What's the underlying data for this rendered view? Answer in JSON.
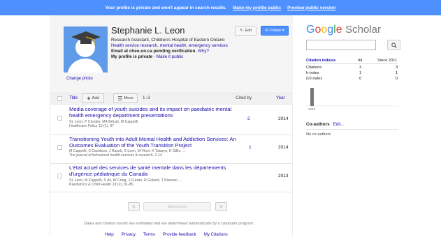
{
  "banner": {
    "message": "Your profile is private and won't appear in search results.",
    "make_public": "Make my profile public",
    "preview": "Preview public version"
  },
  "profile": {
    "name": "Stephanie L. Leon",
    "affiliation": "Research Assistant, Children's Hospital of Eastern Ontario",
    "interests": "Health service research, mental health, emergency services",
    "email_status": "Email at cheo.on.ca pending verification.",
    "email_why": "Why?",
    "private_label": "My profile is private",
    "make_public": "- Make it public",
    "change_photo": "Change photo",
    "edit_label": "Edit",
    "follow_label": "Follow"
  },
  "toolbar": {
    "title": "Title",
    "add": "Add",
    "more": "More",
    "range": "1–3",
    "cited_by": "Cited by",
    "year": "Year"
  },
  "papers": [
    {
      "title": "Media coverage of youth suicides and its impact on paediatric mental health emergency department presentations",
      "authors": "SL Leon, P Cloutier, MA BéLair, M Cappelli",
      "venue": "Healthcare Policy 10 (1), 97",
      "cited": "2",
      "year": "2014"
    },
    {
      "title": "Transitioning Youth into Adult Mental Health and Addiction Services: An Outcomes Evaluation of the Youth Transition Project",
      "authors": "M Cappelli, S Davidson, J Racek, S Leon, M Vloet, K Tataryn, K Gillis, ...",
      "venue": "The journal of behavioral health services & research, 1-14",
      "cited": "1",
      "year": "2014"
    },
    {
      "title": "L'état actuel des services de santé mentale dans les départements d'urgence pédiatrique du Canada",
      "authors": "SL Leon, M Cappelli, S Ali, W Craig, J Curran, R Gokiert, T Klassen, ...",
      "venue": "Paediatrics & Child Health 18 (2), 81-85",
      "cited": "",
      "year": "2013"
    }
  ],
  "pager": {
    "prev": "<",
    "show_more": "Show more",
    "next": ">"
  },
  "footer": {
    "note": "Dates and citation counts are estimated and are determined automatically by a computer program.",
    "links": [
      "Help",
      "Privacy",
      "Terms",
      "Provide feedback",
      "My Citations"
    ]
  },
  "sidebar": {
    "logo_google": [
      "G",
      "o",
      "o",
      "g",
      "l",
      "e"
    ],
    "logo_colors": [
      "#4285f4",
      "#ea4335",
      "#fbbc05",
      "#4285f4",
      "#34a853",
      "#ea4335"
    ],
    "logo_scholar": "Scholar",
    "citation_indices": {
      "header": "Citation indices",
      "col_all": "All",
      "col_since": "Since 2011",
      "rows": [
        {
          "label": "Citations",
          "all": "3",
          "since": "3"
        },
        {
          "label": "h-index",
          "all": "1",
          "since": "1"
        },
        {
          "label": "i10-index",
          "all": "0",
          "since": "0"
        }
      ]
    },
    "coauthors_title": "Co-authors",
    "coauthors_edit": "Edit...",
    "no_coauthors": "No co-authors"
  },
  "chart_data": {
    "type": "bar",
    "categories": [
      "2015"
    ],
    "values": [
      3
    ],
    "color": "#777777"
  },
  "colors": {
    "accent": "#4d90fe",
    "link": "#1a0dab"
  }
}
